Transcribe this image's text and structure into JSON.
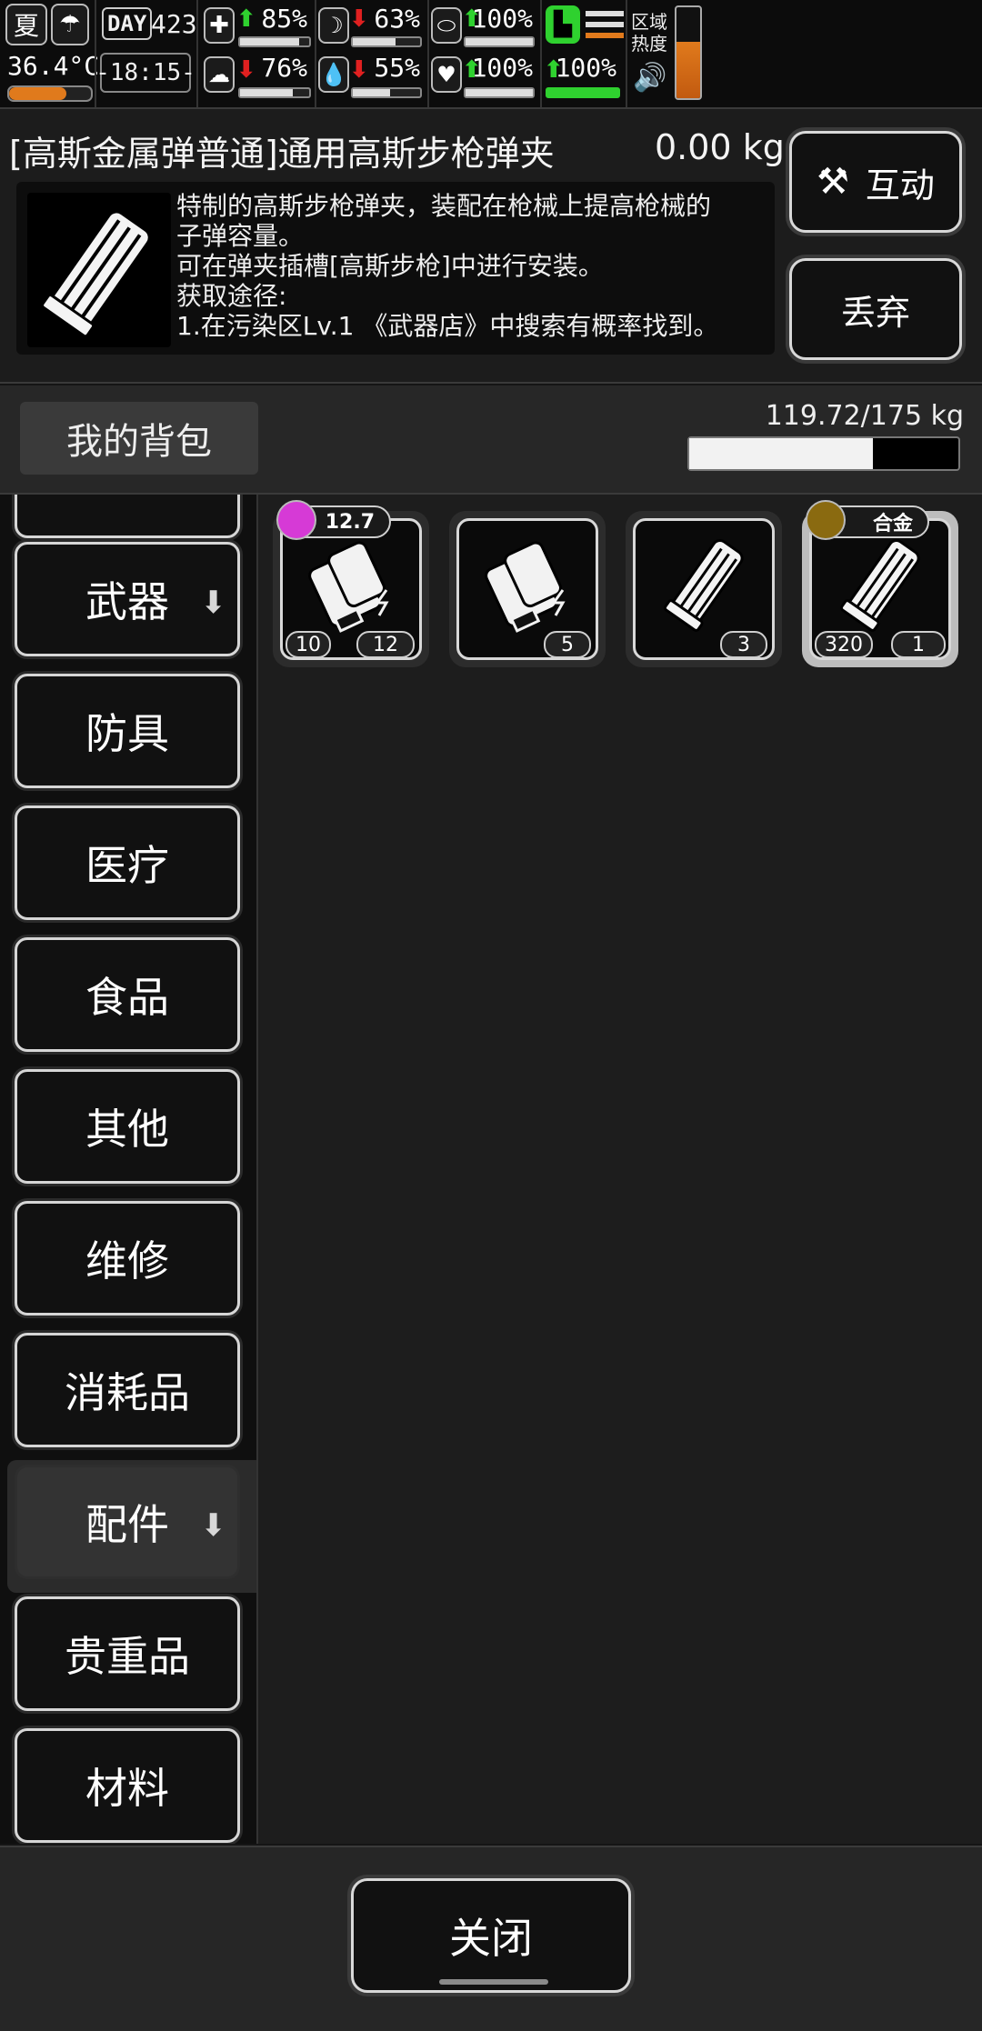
{
  "status": {
    "season": "夏",
    "day_label": "DAY",
    "day_number": "423",
    "temperature": "36.4°C",
    "clock": "-18:15-",
    "health": {
      "pct": "85%",
      "trend": "up",
      "fill": 0.85
    },
    "stomach": {
      "pct": "63%",
      "trend": "down",
      "fill": 0.63
    },
    "stamina": {
      "pct": "100%",
      "trend": "up",
      "fill": 1.0
    },
    "mental": {
      "pct": "76%",
      "trend": "down",
      "fill": 0.76
    },
    "water": {
      "pct": "55%",
      "trend": "down",
      "fill": 0.55
    },
    "heart": {
      "pct": "100%",
      "trend": "up",
      "fill": 1.0
    },
    "leg": {
      "pct": "100%",
      "trend": "up",
      "fill": 1.0
    },
    "zone_heat_label": "区域\n热度",
    "colors": {
      "up": "#2fd12f",
      "down": "#e02020",
      "zone_heat": "#e07a1c"
    }
  },
  "item": {
    "title": "[高斯金属弹普通]通用高斯步枪弹夹",
    "weight": "0.00 kg",
    "description": "特制的高斯步枪弹夹，装配在枪械上提高枪械的\n子弹容量。\n可在弹夹插槽[高斯步枪]中进行安装。\n获取途径:\n1.在污染区Lv.1 《武器店》中搜索有概率找到。",
    "icon": "magazine-icon",
    "interact_label": "互动",
    "interact_icon": "hand-hammer-icon",
    "discard_label": "丢弃"
  },
  "bag": {
    "title": "我的背包",
    "capacity_text": "119.72/175 kg",
    "capacity_fraction": 0.684
  },
  "categories": [
    {
      "label": "武器",
      "arrow": "⬇"
    },
    {
      "label": "防具"
    },
    {
      "label": "医疗"
    },
    {
      "label": "食品"
    },
    {
      "label": "其他"
    },
    {
      "label": "维修"
    },
    {
      "label": "消耗品"
    },
    {
      "label": "配件",
      "arrow": "⬇",
      "active": true
    },
    {
      "label": "贵重品"
    },
    {
      "label": "材料"
    }
  ],
  "slots": [
    {
      "icon": "gauss-ammo-icon",
      "badge": "12.7",
      "badge_color": "#d63ad6",
      "left_count": "10",
      "right_count": "12"
    },
    {
      "icon": "gauss-ammo-icon",
      "right_count": "5"
    },
    {
      "icon": "magazine-icon",
      "right_count": "3"
    },
    {
      "icon": "magazine-icon",
      "badge": "合金",
      "badge_color": "#e0a020",
      "left_count": "320",
      "right_count": "1",
      "selected": true
    }
  ],
  "close_label": "关闭"
}
